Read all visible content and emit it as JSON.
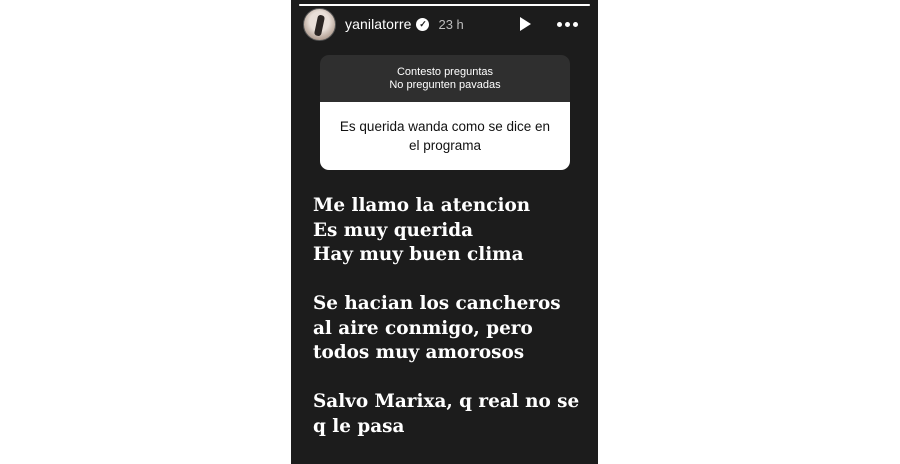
{
  "story": {
    "progress": 1.0,
    "header": {
      "username": "yanilatorre",
      "verified_badge": "verified-badge-icon",
      "time": "23 h",
      "icons": [
        "play-icon",
        "more-options-icon"
      ]
    },
    "question_box": {
      "header_line1": "Contesto preguntas",
      "header_line2": "No pregunten pavadas",
      "question": "Es querida wanda como se dice en el programa"
    },
    "answer": {
      "paragraph1": "Me llamo la atencion\nEs muy querida\nHay muy buen clima",
      "paragraph2": "Se hacian los cancheros\nal aire conmigo, pero\ntodos muy amorosos",
      "paragraph3": "Salvo Marixa, q real no se\nq le pasa"
    },
    "colors": {
      "background": "#1c1c1c",
      "text": "#ffffff",
      "question_header": "#2f2f2f",
      "question_body": "#ffffff"
    }
  }
}
